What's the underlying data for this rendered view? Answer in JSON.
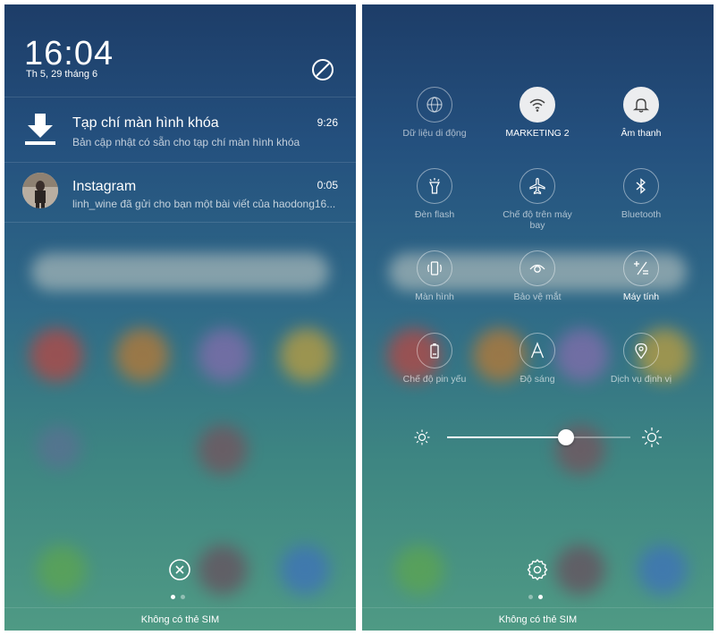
{
  "lockscreen": {
    "time": "16:04",
    "date": "Th 5, 29 tháng 6",
    "notifications": [
      {
        "title": "Tạp chí màn hình khóa",
        "time": "9:26",
        "body": "Bản cập nhật có sẵn cho tạp chí màn hình khóa",
        "icon": "download-icon"
      },
      {
        "title": "Instagram",
        "time": "0:05",
        "body": "linh_wine đã gửi cho bạn một bài viết của haodong16...",
        "icon": "avatar"
      }
    ],
    "page_indicator": {
      "count": 2,
      "active": 0
    }
  },
  "quick_settings": {
    "tiles": [
      {
        "label": "Dữ liệu di động",
        "icon": "globe-icon",
        "active": false
      },
      {
        "label": "MARKETING 2",
        "icon": "wifi-icon",
        "active": true
      },
      {
        "label": "Âm thanh",
        "icon": "bell-icon",
        "active": true
      },
      {
        "label": "Đèn flash",
        "icon": "flashlight-icon",
        "active": false
      },
      {
        "label": "Chế độ trên máy bay",
        "icon": "airplane-icon",
        "active": false
      },
      {
        "label": "Bluetooth",
        "icon": "bluetooth-icon",
        "active": false
      },
      {
        "label": "Màn hình",
        "icon": "screen-rotate-icon",
        "active": false
      },
      {
        "label": "Bảo vệ mắt",
        "icon": "eye-protection-icon",
        "active": false
      },
      {
        "label": "Máy tính",
        "icon": "calculator-icon",
        "active": true
      },
      {
        "label": "Chế độ pin yếu",
        "icon": "battery-saver-icon",
        "active": false
      },
      {
        "label": "Độ sáng",
        "icon": "auto-brightness-icon",
        "active": false
      },
      {
        "label": "Dịch vụ định vị",
        "icon": "location-icon",
        "active": false
      }
    ],
    "brightness": 0.65,
    "page_indicator": {
      "count": 2,
      "active": 1
    }
  },
  "status": {
    "no_sim": "Không có thẻ SIM"
  }
}
